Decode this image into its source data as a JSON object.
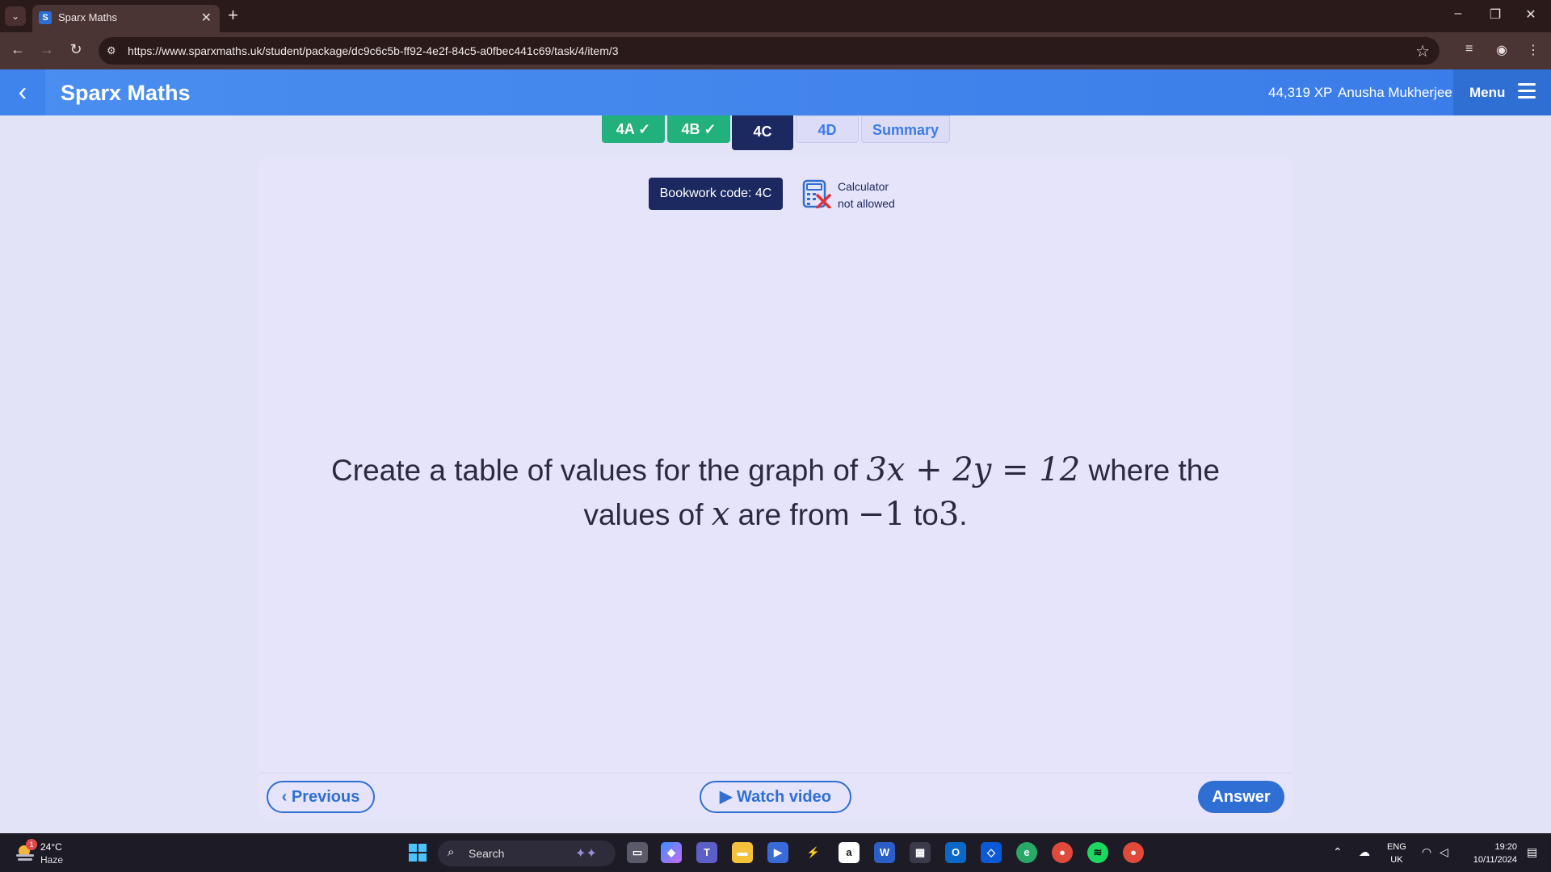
{
  "browser": {
    "tab_title": "Sparx Maths",
    "tab_favicon": "S",
    "url": "https://www.sparxmaths.uk/student/package/dc9c6c5b-ff92-4e2f-84c5-a0fbec441c69/task/4/item/3"
  },
  "header": {
    "brand": "Sparx Maths",
    "xp": "44,319 XP",
    "user_name": "Anusha Mukherjee",
    "menu_label": "Menu"
  },
  "tasks": [
    {
      "label": "4A",
      "status": "complete"
    },
    {
      "label": "4B",
      "status": "complete"
    },
    {
      "label": "4C",
      "status": "active"
    },
    {
      "label": "4D",
      "status": "incomplete"
    },
    {
      "label": "Summary",
      "status": "incomplete"
    }
  ],
  "question": {
    "bookwork_code": "Bookwork code: 4C",
    "calculator_line1": "Calculator",
    "calculator_line2": "not allowed",
    "text_part1": "Create a table of values for the graph of",
    "equation": "3x + 2y = 12",
    "text_part2": "where the values of",
    "variable": "x",
    "text_part3": "are from",
    "range_start": "−1",
    "text_part4": "to",
    "range_end": "3",
    "text_end": "."
  },
  "footer": {
    "previous_label": "Previous",
    "watch_video_label": "Watch video",
    "answer_label": "Answer"
  },
  "taskbar": {
    "weather_temp": "24°C",
    "weather_desc": "Haze",
    "weather_badge": "1",
    "search_placeholder": "Search",
    "lang_line1": "ENG",
    "lang_line2": "UK",
    "time": "19:20",
    "date": "10/11/2024"
  },
  "colors": {
    "header_blue": "#3a7ce8",
    "complete_green": "#22b07d",
    "active_navy": "#1c2860",
    "card_bg": "#e6e4fa"
  }
}
